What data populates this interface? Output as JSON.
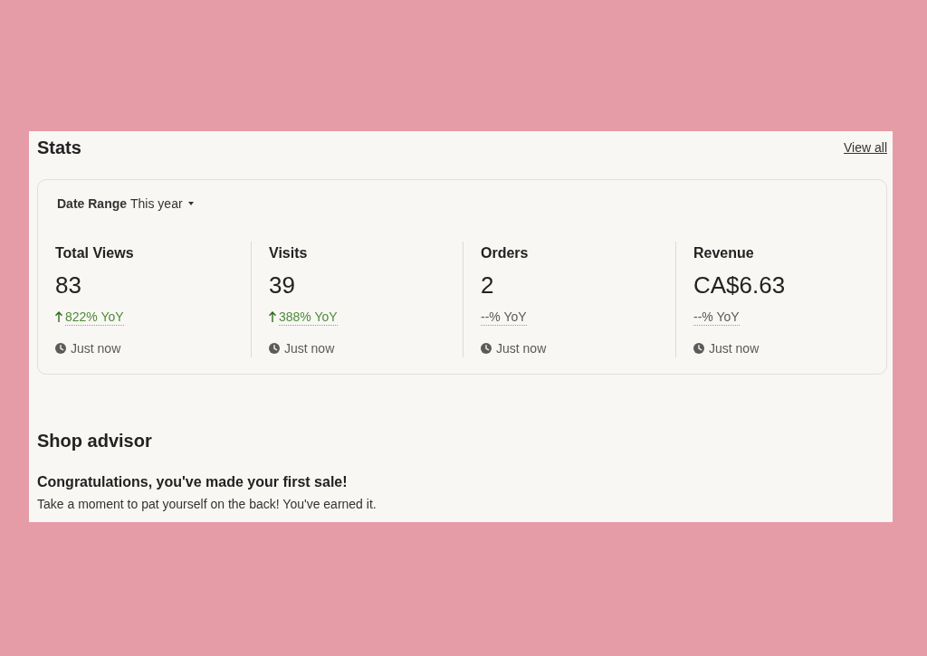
{
  "stats": {
    "title": "Stats",
    "view_all": "View all",
    "date_range": {
      "label": "Date Range",
      "value": "This year"
    },
    "metrics": [
      {
        "label": "Total Views",
        "value": "83",
        "kind": "increase",
        "change": "822% YoY",
        "updated": "Just now"
      },
      {
        "label": "Visits",
        "value": "39",
        "kind": "increase",
        "change": "388% YoY",
        "updated": "Just now"
      },
      {
        "label": "Orders",
        "value": "2",
        "kind": "neutral",
        "change": "--% YoY",
        "updated": "Just now"
      },
      {
        "label": "Revenue",
        "value": "CA$6.63",
        "kind": "neutral",
        "change": "--% YoY",
        "updated": "Just now"
      }
    ]
  },
  "shop_advisor": {
    "title": "Shop advisor",
    "heading": "Congratulations, you've made your first sale!",
    "body": "Take a moment to pat yourself on the back! You've earned it."
  }
}
